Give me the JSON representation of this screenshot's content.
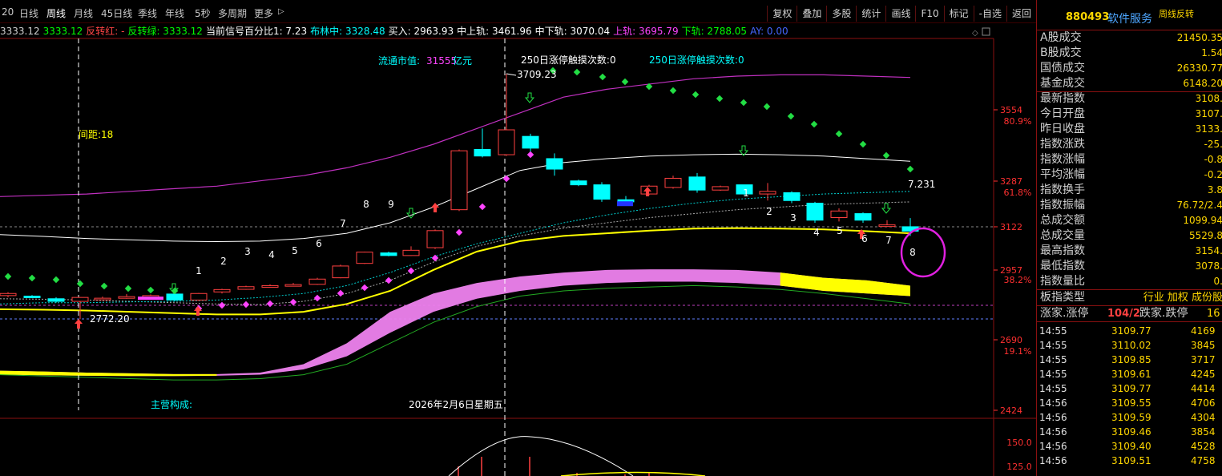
{
  "toolbar": {
    "periods": [
      "20",
      "日线",
      "周线",
      "月线",
      "45日线",
      "季线",
      "年线",
      "5秒",
      "多周期",
      "更多"
    ],
    "active_period": "周线",
    "more_arrow": "▷",
    "tools": [
      "复权",
      "叠加",
      "多股",
      "统计",
      "画线",
      "F10",
      "标记",
      "-自选",
      "返回"
    ]
  },
  "indicator_line": {
    "items": [
      {
        "text": "3333.12",
        "color": "#d0d0d0"
      },
      {
        "text": "3333.12",
        "color": "#00ff00"
      },
      {
        "text": "反转红: -",
        "color": "#ff4444"
      },
      {
        "text": "反转绿: 3333.12",
        "color": "#00ff00"
      },
      {
        "text": "当前信号百分比1: 7.23",
        "color": "#ffffff"
      },
      {
        "text": "布林中: 3328.48",
        "color": "#00ffff"
      },
      {
        "text": "买入: 2963.93",
        "color": "#ffffff"
      },
      {
        "text": "中上轨: 3461.96",
        "color": "#ffffff"
      },
      {
        "text": "中下轨: 3070.04",
        "color": "#ffffff"
      },
      {
        "text": "上轨: 3695.79",
        "color": "#ff44ff"
      },
      {
        "text": "下轨: 2788.05",
        "color": "#00ff00"
      },
      {
        "text": "AY: 0.00",
        "color": "#4466ff"
      }
    ]
  },
  "chart_labels": {
    "float_mv_label": "流通市值:",
    "float_mv_value": "31555",
    "float_mv_unit": "亿元",
    "touch_a": "250日涨停触摸次数:0",
    "touch_b": "250日涨停触摸次数:0",
    "spacing": "间距:18",
    "high_mark": "3709.23",
    "low_mark": "2772.20",
    "signal_value": "7.231",
    "main_comp": "主营构成:",
    "date_label": "2026年2月6日星期五"
  },
  "counts": {
    "left": [
      "1",
      "2",
      "3",
      "4",
      "5",
      "6",
      "7",
      "8",
      "9"
    ],
    "right": [
      "1",
      "2",
      "3",
      "4",
      "5",
      "6",
      "7",
      "8"
    ]
  },
  "y_axis": {
    "ticks": [
      "3554",
      "3287",
      "3122",
      "2957",
      "2690",
      "2424"
    ],
    "percents": [
      "80.9%",
      "61.8%",
      "38.2%",
      "19.1%"
    ],
    "lower_ticks": [
      "150.0",
      "125.0"
    ]
  },
  "chart_data": {
    "type": "candlestick",
    "timeframe": "周线",
    "y_range_price": [
      2424,
      3700
    ],
    "candles": [
      {
        "o": 2870,
        "h": 2875,
        "l": 2855,
        "c": 2862,
        "dir": "up"
      },
      {
        "o": 2860,
        "h": 2864,
        "l": 2852,
        "c": 2858,
        "dir": "down"
      },
      {
        "o": 2850,
        "h": 2856,
        "l": 2835,
        "c": 2840,
        "dir": "down"
      },
      {
        "o": 2840,
        "h": 2850,
        "l": 2772.2,
        "c": 2855,
        "dir": "up"
      },
      {
        "o": 2848,
        "h": 2858,
        "l": 2845,
        "c": 2852,
        "dir": "up"
      },
      {
        "o": 2853,
        "h": 2868,
        "l": 2850,
        "c": 2858,
        "dir": "up"
      },
      {
        "o": 2860,
        "h": 2866,
        "l": 2855,
        "c": 2862,
        "dir": "up"
      },
      {
        "o": 2868,
        "h": 2870,
        "l": 2840,
        "c": 2845,
        "dir": "down"
      },
      {
        "o": 2845,
        "h": 2872,
        "l": 2842,
        "c": 2870,
        "dir": "up"
      },
      {
        "o": 2876,
        "h": 2888,
        "l": 2870,
        "c": 2885,
        "dir": "up"
      },
      {
        "o": 2886,
        "h": 2900,
        "l": 2884,
        "c": 2896,
        "dir": "up"
      },
      {
        "o": 2898,
        "h": 2905,
        "l": 2896,
        "c": 2900,
        "dir": "up"
      },
      {
        "o": 2900,
        "h": 2910,
        "l": 2898,
        "c": 2904,
        "dir": "up"
      },
      {
        "o": 2905,
        "h": 2930,
        "l": 2903,
        "c": 2925,
        "dir": "up"
      },
      {
        "o": 2930,
        "h": 2980,
        "l": 2928,
        "c": 2975,
        "dir": "up"
      },
      {
        "o": 2985,
        "h": 3030,
        "l": 2983,
        "c": 3028,
        "dir": "up"
      },
      {
        "o": 3025,
        "h": 3030,
        "l": 3012,
        "c": 3015,
        "dir": "down"
      },
      {
        "o": 3015,
        "h": 3050,
        "l": 3013,
        "c": 3035,
        "dir": "up"
      },
      {
        "o": 3045,
        "h": 3115,
        "l": 3040,
        "c": 3110,
        "dir": "up"
      },
      {
        "o": 3190,
        "h": 3420,
        "l": 3185,
        "c": 3415,
        "dir": "up"
      },
      {
        "o": 3420,
        "h": 3500,
        "l": 3390,
        "c": 3395,
        "dir": "down"
      },
      {
        "o": 3400,
        "h": 3709.23,
        "l": 3395,
        "c": 3495,
        "dir": "up"
      },
      {
        "o": 3470,
        "h": 3480,
        "l": 3405,
        "c": 3425,
        "dir": "down"
      },
      {
        "o": 3385,
        "h": 3405,
        "l": 3320,
        "c": 3345,
        "dir": "down"
      },
      {
        "o": 3300,
        "h": 3305,
        "l": 3280,
        "c": 3285,
        "dir": "down"
      },
      {
        "o": 3285,
        "h": 3295,
        "l": 3220,
        "c": 3230,
        "dir": "down"
      },
      {
        "o": 3228,
        "h": 3242,
        "l": 3218,
        "c": 3220,
        "dir": "down"
      },
      {
        "o": 3250,
        "h": 3285,
        "l": 3245,
        "c": 3280,
        "dir": "up"
      },
      {
        "o": 3275,
        "h": 3320,
        "l": 3270,
        "c": 3310,
        "dir": "up"
      },
      {
        "o": 3315,
        "h": 3330,
        "l": 3255,
        "c": 3265,
        "dir": "down"
      },
      {
        "o": 3265,
        "h": 3282,
        "l": 3262,
        "c": 3278,
        "dir": "up"
      },
      {
        "o": 3285,
        "h": 3285,
        "l": 3245,
        "c": 3250,
        "dir": "down"
      },
      {
        "o": 3250,
        "h": 3292,
        "l": 3225,
        "c": 3260,
        "dir": "up"
      },
      {
        "o": 3255,
        "h": 3260,
        "l": 3215,
        "c": 3225,
        "dir": "down"
      },
      {
        "o": 3215,
        "h": 3220,
        "l": 3140,
        "c": 3150,
        "dir": "down"
      },
      {
        "o": 3160,
        "h": 3195,
        "l": 3145,
        "c": 3185,
        "dir": "up"
      },
      {
        "o": 3175,
        "h": 3180,
        "l": 3140,
        "c": 3150,
        "dir": "down"
      },
      {
        "o": 3130,
        "h": 3150,
        "l": 3128,
        "c": 3132,
        "dir": "up"
      },
      {
        "o": 3125,
        "h": 3158,
        "l": 3090,
        "c": 3108,
        "dir": "down"
      }
    ],
    "lines": {
      "upper_band_magenta": [
        3240,
        3245,
        3250,
        3260,
        3270,
        3280,
        3300,
        3320,
        3350,
        3390,
        3440,
        3500,
        3560,
        3620,
        3650,
        3670,
        3690,
        3700,
        3705,
        3705,
        3700,
        3695
      ],
      "mid_white": [
        3095,
        3088,
        3080,
        3075,
        3070,
        3068,
        3070,
        3080,
        3100,
        3140,
        3200,
        3270,
        3340,
        3370,
        3385,
        3395,
        3400,
        3402,
        3400,
        3395,
        3385,
        3375
      ],
      "yellow": [
        2810,
        2808,
        2805,
        2800,
        2795,
        2790,
        2790,
        2800,
        2830,
        2880,
        2960,
        3030,
        3070,
        3090,
        3100,
        3110,
        3118,
        3120,
        3118,
        3115,
        3108,
        3100
      ],
      "lower_green": [
        2560,
        2555,
        2550,
        2545,
        2540,
        2540,
        2545,
        2560,
        2600,
        2680,
        2760,
        2820,
        2860,
        2880,
        2890,
        2895,
        2900,
        2895,
        2885,
        2870,
        2850,
        2830
      ]
    }
  },
  "right_panel": {
    "code": "880493",
    "name": "软件服务",
    "tag": "周线反转",
    "rows": [
      {
        "label": "A股成交",
        "value": "21450.35"
      },
      {
        "label": "B股成交",
        "value": "1.54"
      },
      {
        "label": "国债成交",
        "value": "26330.77"
      },
      {
        "label": "基金成交",
        "value": "6148.20"
      },
      {
        "label": "最新指数",
        "value": "3108."
      },
      {
        "label": "今日开盘",
        "value": "3107."
      },
      {
        "label": "昨日收盘",
        "value": "3133."
      },
      {
        "label": "指数涨跌",
        "value": "-25."
      },
      {
        "label": "指数涨幅",
        "value": "-0.8"
      },
      {
        "label": "平均涨幅",
        "value": "-0.2"
      },
      {
        "label": "指数换手",
        "value": "3.8"
      },
      {
        "label": "指数振幅",
        "value": "76.72/2.4"
      },
      {
        "label": "总成交额",
        "value": "1099.94"
      },
      {
        "label": "总成交量",
        "value": "5529.8"
      },
      {
        "label": "最高指数",
        "value": "3154."
      },
      {
        "label": "最低指数",
        "value": "3078."
      },
      {
        "label": "指数量比",
        "value": "0."
      }
    ],
    "board_type_label": "板指类型",
    "board_type_value": "行业 加权 成份股",
    "limit_up_label": "涨家.涨停",
    "limit_up_value": "104/2",
    "limit_down_label": "跌家.跌停",
    "limit_down_value": "16",
    "ticks": [
      {
        "t": "14:55",
        "p": "3109.77",
        "v": "4169"
      },
      {
        "t": "14:55",
        "p": "3110.02",
        "v": "3845"
      },
      {
        "t": "14:55",
        "p": "3109.85",
        "v": "3717"
      },
      {
        "t": "14:55",
        "p": "3109.61",
        "v": "4245"
      },
      {
        "t": "14:55",
        "p": "3109.77",
        "v": "4414"
      },
      {
        "t": "14:56",
        "p": "3109.55",
        "v": "4706"
      },
      {
        "t": "14:56",
        "p": "3109.59",
        "v": "4304"
      },
      {
        "t": "14:56",
        "p": "3109.46",
        "v": "3854"
      },
      {
        "t": "14:56",
        "p": "3109.40",
        "v": "4528"
      },
      {
        "t": "14:56",
        "p": "3109.51",
        "v": "4758"
      }
    ]
  },
  "colors": {
    "up": "#ff4040",
    "down": "#00ffff",
    "magenta": "#ff44ff",
    "yellow": "#ffff00",
    "pink_fill": "#ee82ee",
    "green": "#33cc33",
    "grid_red": "#8a1010"
  }
}
